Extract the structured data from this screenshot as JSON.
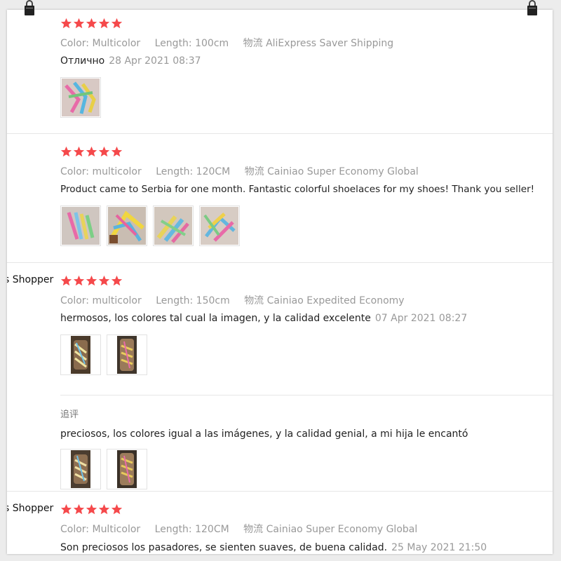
{
  "reviews": [
    {
      "buyer": "",
      "rating": 5,
      "color_key": "Color:",
      "color_val": "Multicolor",
      "length_key": "Length:",
      "length_val": "100cm",
      "ship_key": "物流",
      "ship_val": "AliExpress Saver Shipping",
      "text": "Отлично",
      "date": "28 Apr 2021 08:37",
      "photos": 1
    },
    {
      "buyer": "",
      "rating": 5,
      "color_key": "Color:",
      "color_val": "multicolor",
      "length_key": "Length:",
      "length_val": "120CM",
      "ship_key": "物流",
      "ship_val": "Cainiao Super Economy Global",
      "text": "Product came to Serbia for one month. Fantastic colorful shoelaces for my shoes! Thank you seller!",
      "date": "",
      "photos": 4
    },
    {
      "buyer": "s Shopper",
      "rating": 5,
      "color_key": "Color:",
      "color_val": "multicolor",
      "length_key": "Length:",
      "length_val": "150cm",
      "ship_key": "物流",
      "ship_val": "Cainiao Expedited Economy",
      "text": "hermosos, los colores tal cual la imagen, y la calidad excelente",
      "date": "07 Apr 2021 08:27",
      "photos": 2,
      "followup_label": "追评",
      "followup_text": "preciosos, los colores igual a las imágenes, y la calidad genial, a mi hija le encantó",
      "followup_photos": 2
    },
    {
      "buyer": "s Shopper",
      "rating": 5,
      "color_key": "Color:",
      "color_val": "Multicolor",
      "length_key": "Length:",
      "length_val": "120CM",
      "ship_key": "物流",
      "ship_val": "Cainiao Super Economy Global",
      "text": "Son preciosos los pasadores, se sienten suaves, de buena calidad.",
      "date": "25 May 2021 21:50"
    }
  ],
  "colors": {
    "star": "#f5494b",
    "muted": "#999999",
    "text": "#222222"
  }
}
